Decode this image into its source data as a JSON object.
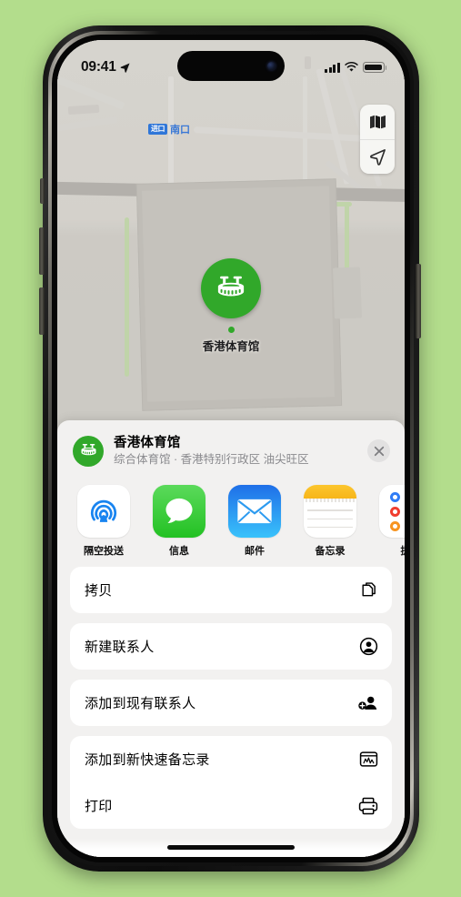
{
  "device": {
    "status_bar": {
      "time": "09:41",
      "location_icon": "location-arrow-icon",
      "signal_icon": "cellular-bars-icon",
      "wifi_icon": "wifi-icon",
      "battery_icon": "battery-icon"
    }
  },
  "map": {
    "entrance_badge": "进口",
    "entrance_label": "南口",
    "pin_label": "香港体育馆",
    "controls": [
      {
        "name": "map-layers-button",
        "icon": "folded-map-icon"
      },
      {
        "name": "current-location-button",
        "icon": "navigation-arrow-icon"
      }
    ]
  },
  "share_sheet": {
    "title": "香港体育馆",
    "subtitle": "综合体育馆 · 香港特别行政区 油尖旺区",
    "close_label": "✕",
    "apps": [
      {
        "label": "隔空投送",
        "icon": "airdrop-icon",
        "highlighted": false
      },
      {
        "label": "信息",
        "icon": "messages-icon",
        "highlighted": false
      },
      {
        "label": "邮件",
        "icon": "mail-icon",
        "highlighted": false
      },
      {
        "label": "备忘录",
        "icon": "notes-icon",
        "highlighted": true
      },
      {
        "label": "提",
        "icon": "reminders-icon",
        "highlighted": false
      }
    ],
    "actions": [
      {
        "label": "拷贝",
        "icon": "copy-icon"
      },
      {
        "label": "新建联系人",
        "icon": "person-circle-icon"
      },
      {
        "label": "添加到现有联系人",
        "icon": "person-add-icon"
      },
      {
        "label": "添加到新快速备忘录",
        "icon": "quick-note-icon"
      },
      {
        "label": "打印",
        "icon": "printer-icon"
      }
    ]
  },
  "annotation": {
    "highlight_color": "#f51616"
  }
}
